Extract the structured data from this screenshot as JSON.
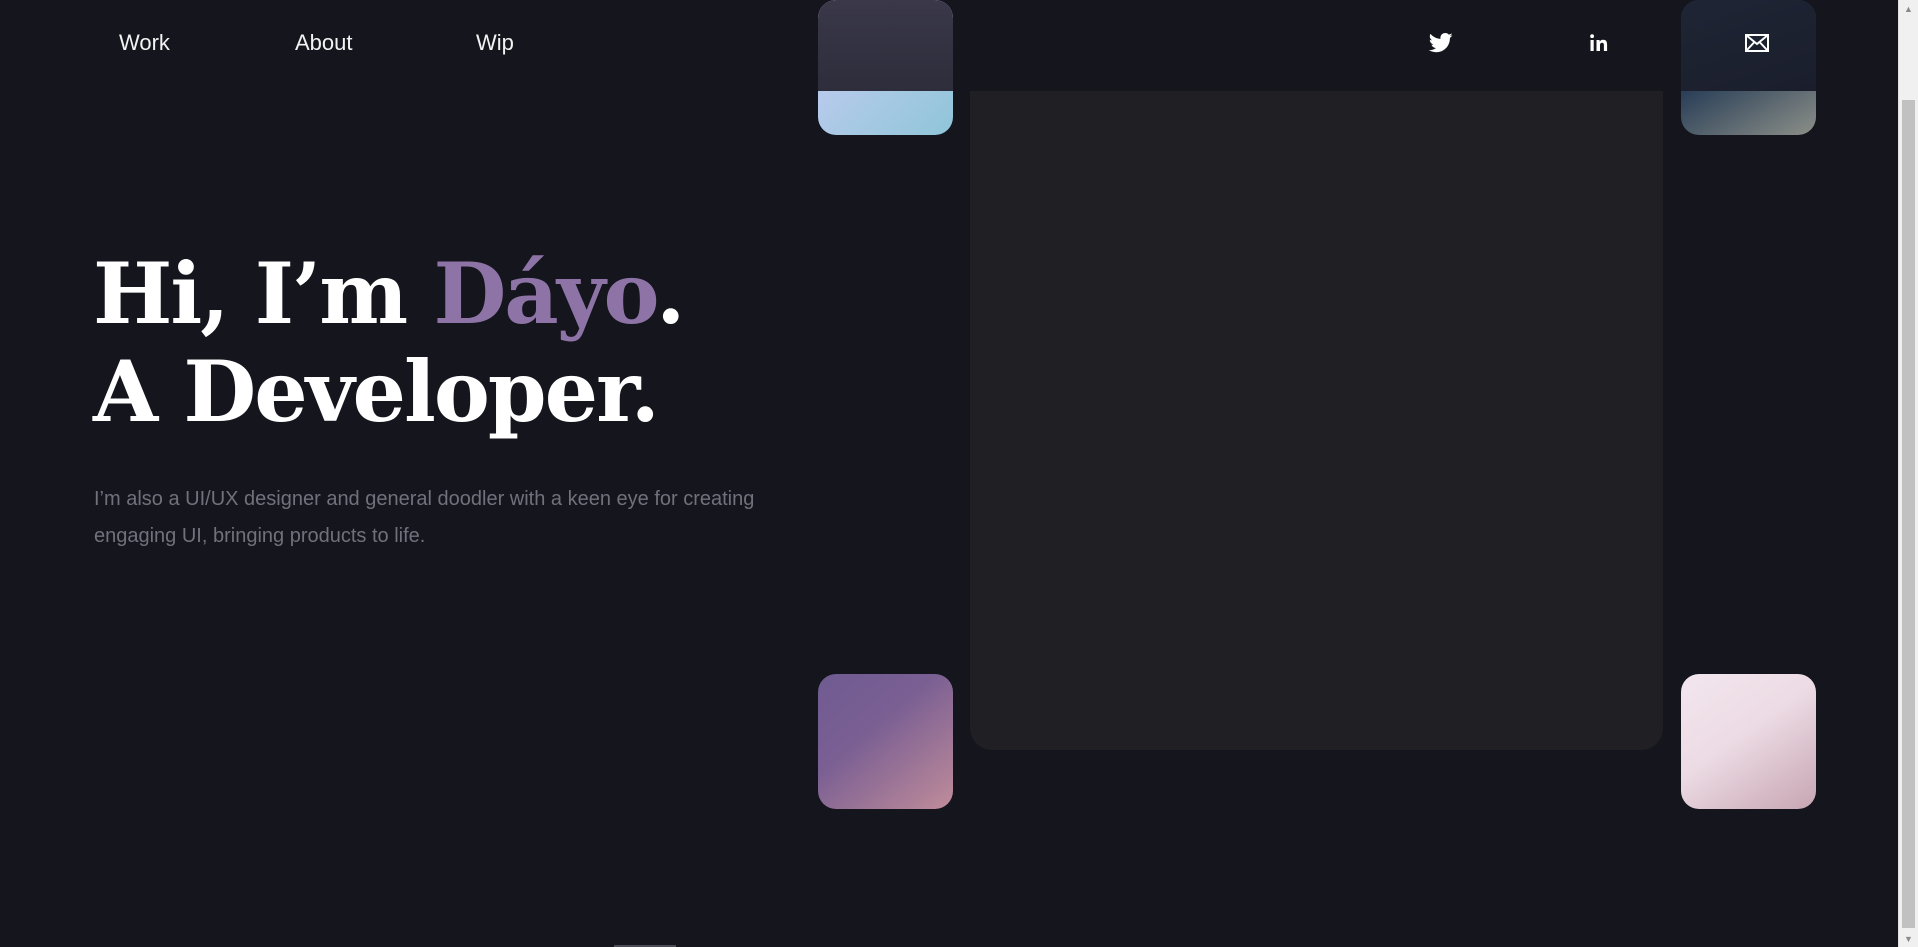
{
  "nav": {
    "links": [
      {
        "label": "Work"
      },
      {
        "label": "About"
      },
      {
        "label": "Wip"
      }
    ],
    "social": [
      {
        "icon": "twitter-icon"
      },
      {
        "icon": "linkedin-icon"
      },
      {
        "icon": "mail-icon"
      }
    ]
  },
  "hero": {
    "greeting": "Hi, I’m ",
    "name": "Dáyo",
    "period": ".",
    "role": "A Developer.",
    "description": "I’m also a UI/UX designer and general doodler with a keen eye for creating engaging UI, bringing products to life."
  },
  "colors": {
    "background": "#15151e",
    "accent": "#8e74a6",
    "text": "#ffffff",
    "muted": "#71707c",
    "panel": "#1f1f24"
  }
}
